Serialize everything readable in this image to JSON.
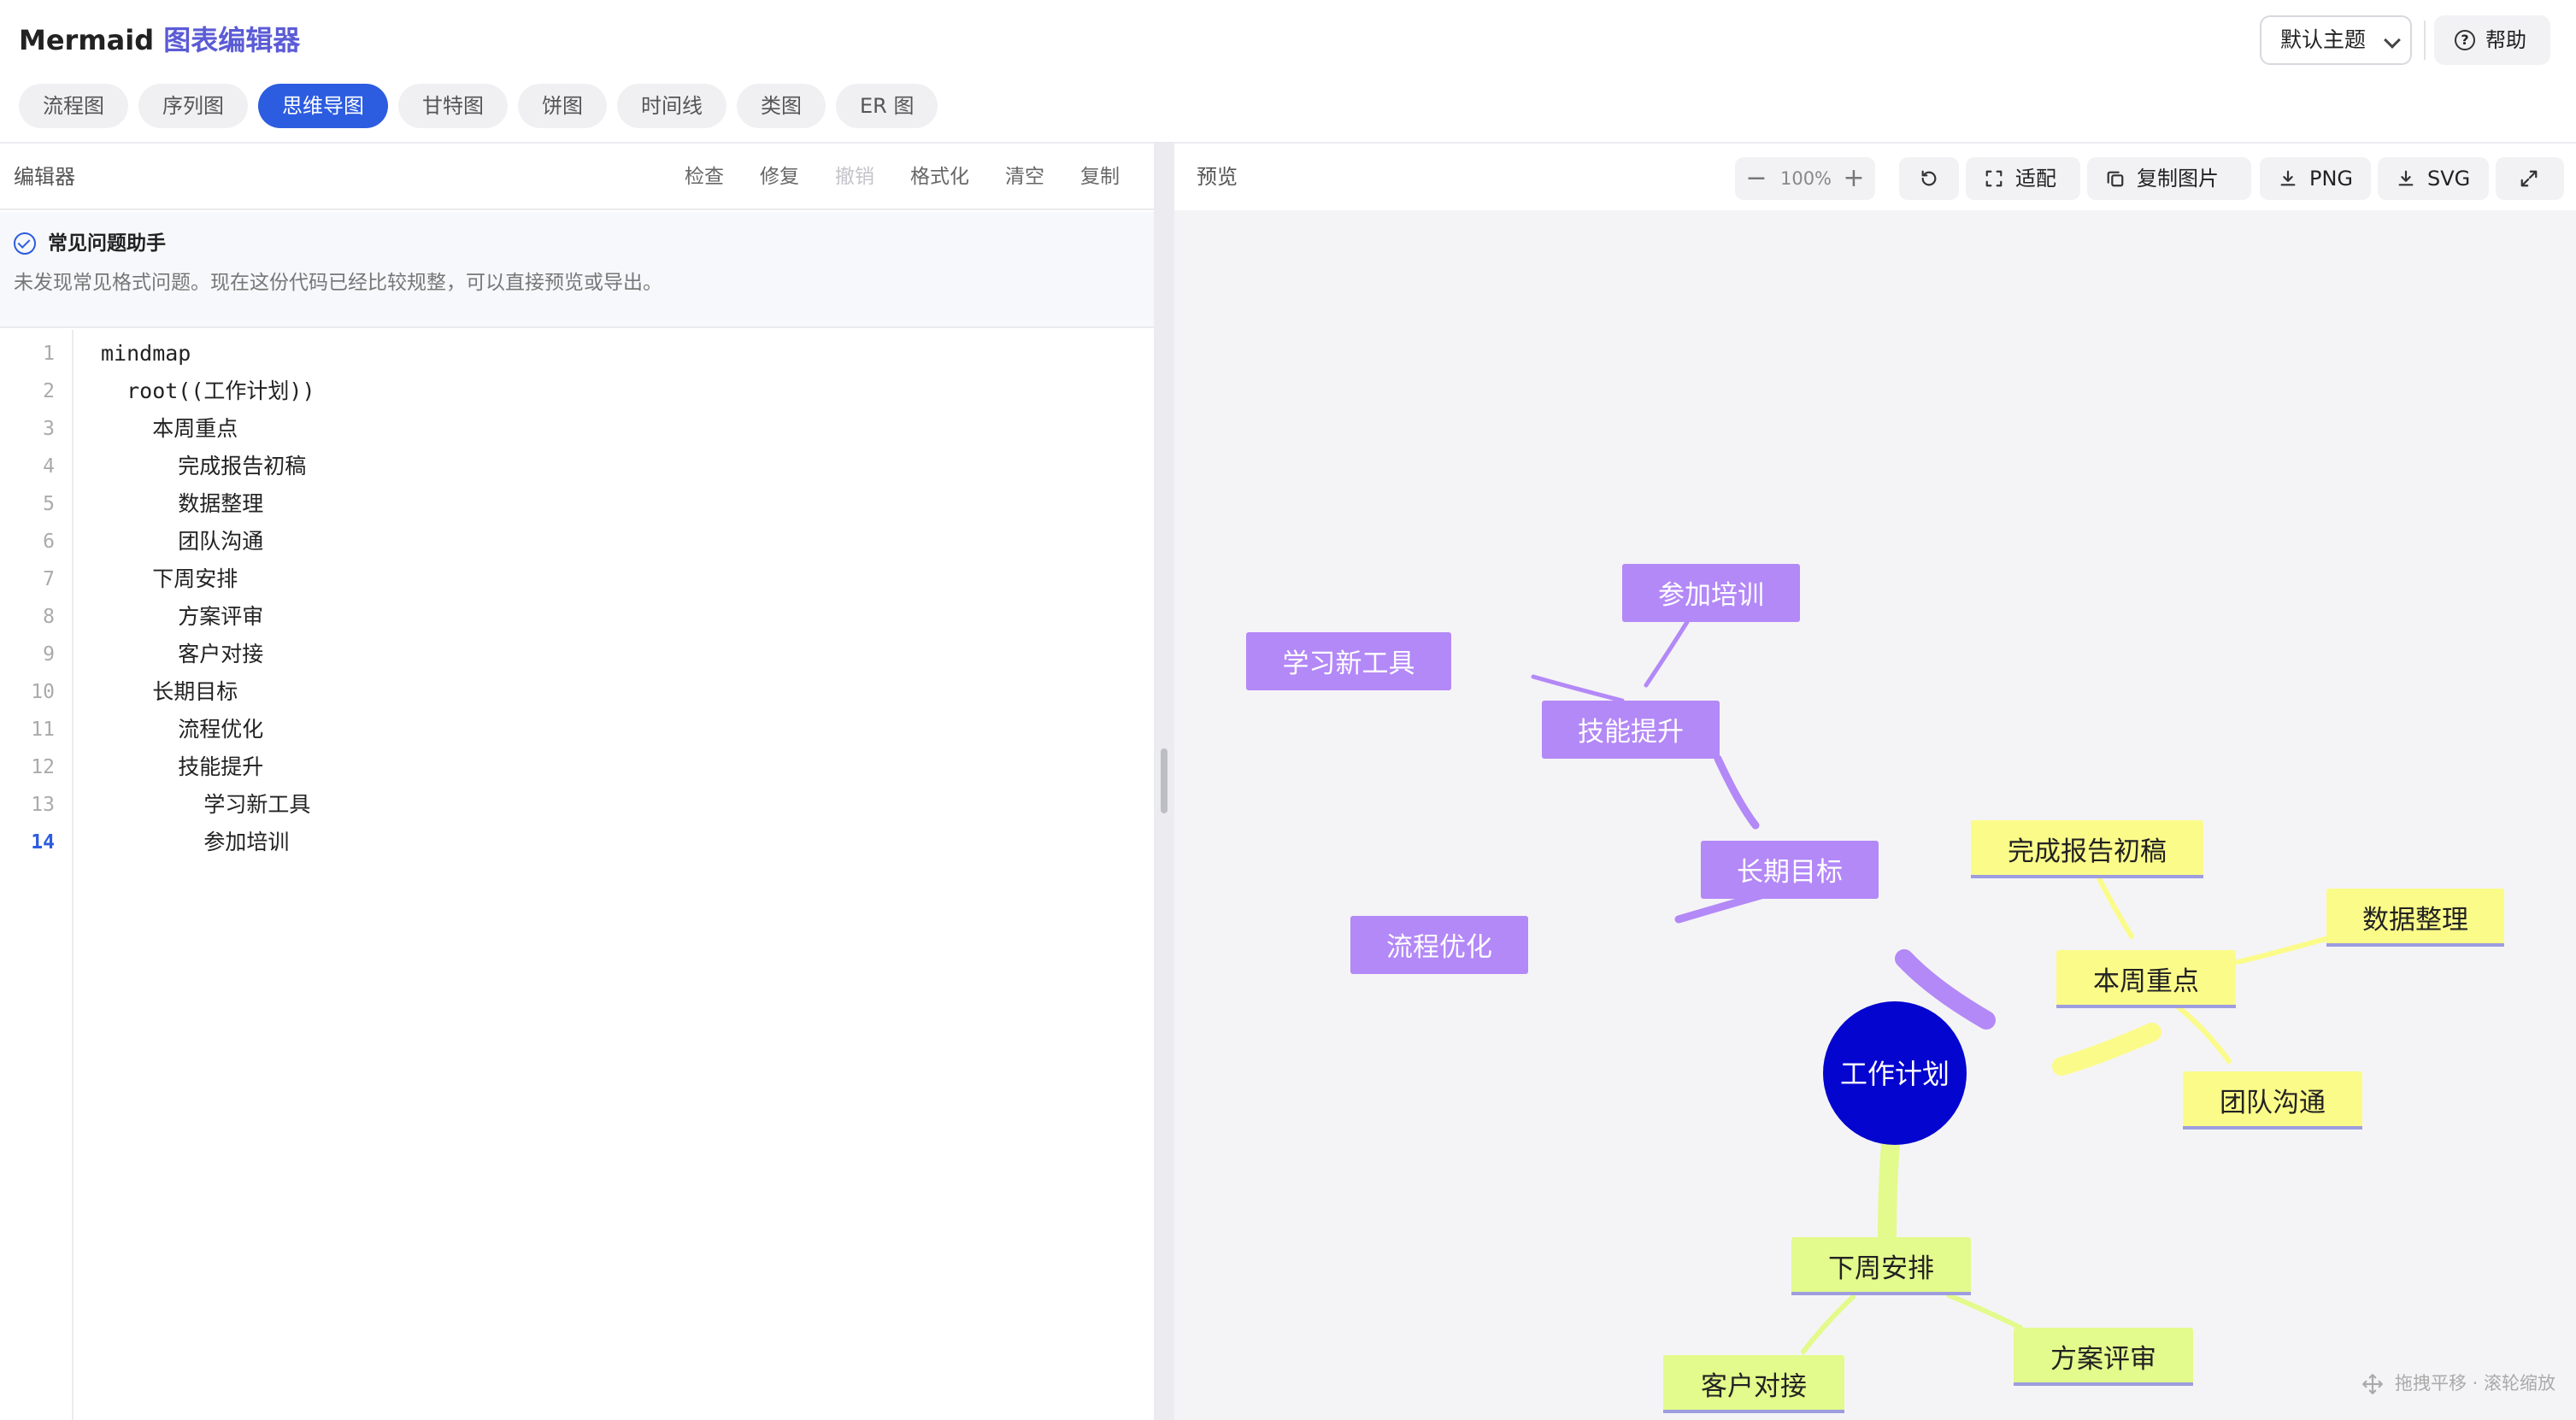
{
  "header": {
    "title_brand": "Mermaid",
    "title_rest": "图表编辑器",
    "theme_select": "默认主题",
    "help_label": "帮助",
    "tabs": [
      {
        "label": "流程图"
      },
      {
        "label": "序列图"
      },
      {
        "label": "思维导图"
      },
      {
        "label": "甘特图"
      },
      {
        "label": "饼图"
      },
      {
        "label": "时间线"
      },
      {
        "label": "类图"
      },
      {
        "label": "ER 图"
      }
    ],
    "active_tab": "思维导图"
  },
  "editor": {
    "title": "编辑器",
    "actions": {
      "check": "检查",
      "fix": "修复",
      "undo": "撤销",
      "format": "格式化",
      "clear": "清空",
      "copy": "复制"
    },
    "assistant": {
      "title": "常见问题助手",
      "message": "未发现常见格式问题。现在这份代码已经比较规整，可以直接预览或导出。"
    },
    "current_line": 14,
    "lines": [
      "mindmap",
      "  root((工作计划))",
      "    本周重点",
      "      完成报告初稿",
      "      数据整理",
      "      团队沟通",
      "    下周安排",
      "      方案评审",
      "      客户对接",
      "    长期目标",
      "      流程优化",
      "      技能提升",
      "        学习新工具",
      "        参加培训"
    ]
  },
  "preview": {
    "title": "预览",
    "zoom_level": "100%",
    "zoom_minus": "−",
    "zoom_plus": "+",
    "fit_label": "适配",
    "copy_image_label": "复制图片",
    "png_label": "PNG",
    "svg_label": "SVG",
    "hint": "拖拽平移 · 滚轮缩放"
  },
  "mindmap": {
    "root": "工作计划",
    "branches": {
      "this_week": {
        "label": "本周重点",
        "children": [
          "完成报告初稿",
          "数据整理",
          "团队沟通"
        ]
      },
      "next_week": {
        "label": "下周安排",
        "children": [
          "方案评审",
          "客户对接"
        ]
      },
      "long_term": {
        "label": "长期目标",
        "children": [
          "流程优化",
          "技能提升"
        ],
        "skill_children": [
          "学习新工具",
          "参加培训"
        ]
      }
    }
  },
  "colors": {
    "accent": "#2c5ce0",
    "root_node": "#0505d0",
    "purple_branch": "#b388f7",
    "yellow_branch": "#fbfb8a",
    "green_branch": "#e3fa8c"
  }
}
